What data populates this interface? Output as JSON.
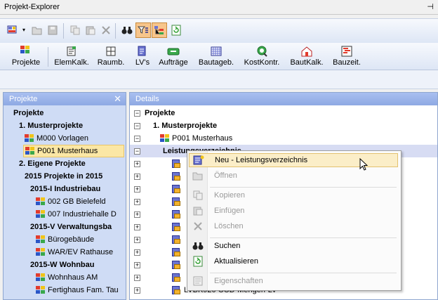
{
  "window": {
    "title": "Projekt-Explorer",
    "pin_icon": "pin-icon"
  },
  "toolbar": {
    "buttons": [
      {
        "name": "new-project-dropdown",
        "icon": "project-grid-icon"
      },
      {
        "name": "open-folder",
        "icon": "folder-open-icon"
      },
      {
        "name": "save",
        "icon": "save-icon"
      },
      {
        "name": "copy",
        "icon": "copy-icon"
      },
      {
        "name": "paste",
        "icon": "paste-icon"
      },
      {
        "name": "delete",
        "icon": "delete-icon"
      },
      {
        "name": "search",
        "icon": "binoculars-icon"
      },
      {
        "name": "filter",
        "icon": "filter-icon",
        "active": true
      },
      {
        "name": "tree-view",
        "icon": "tree-view-icon",
        "active": true
      },
      {
        "name": "refresh",
        "icon": "refresh-icon"
      }
    ]
  },
  "nav": {
    "items": [
      {
        "label": "Projekte",
        "icon": "projects-icon"
      },
      {
        "label": "ElemKalk.",
        "icon": "element-calc-icon"
      },
      {
        "label": "Raumb.",
        "icon": "room-book-icon"
      },
      {
        "label": "LV's",
        "icon": "lv-icon"
      },
      {
        "label": "Aufträge",
        "icon": "orders-icon"
      },
      {
        "label": "Bautageb.",
        "icon": "diary-icon"
      },
      {
        "label": "KostKontr.",
        "icon": "cost-control-icon"
      },
      {
        "label": "BautKalk.",
        "icon": "construction-calc-icon"
      },
      {
        "label": "Bauzeit.",
        "icon": "schedule-icon"
      }
    ]
  },
  "left_panel": {
    "title": "Projekte",
    "tree": [
      {
        "label": "Projekte",
        "bold": true
      },
      {
        "label": "1. Musterprojekte",
        "bold": true
      },
      {
        "label": "M000 Vorlagen"
      },
      {
        "label": "P001 Musterhaus",
        "selected": true
      },
      {
        "label": "2. Eigene Projekte",
        "bold": true
      },
      {
        "label": "2015 Projekte in 2015",
        "bold": true
      },
      {
        "label": "2015-I Industriebau",
        "bold": true
      },
      {
        "label": "002 GB Bielefeld"
      },
      {
        "label": "007 Industriehalle D"
      },
      {
        "label": "2015-V Verwaltungsba",
        "bold": true
      },
      {
        "label": "Bürogebäude"
      },
      {
        "label": "WAR/EV Rathause"
      },
      {
        "label": "2015-W Wohnbau",
        "bold": true
      },
      {
        "label": "Wohnhaus AM"
      },
      {
        "label": "Fertighaus Fam. Tau"
      }
    ]
  },
  "right_panel": {
    "title": "Details",
    "tree": [
      {
        "label": "Projekte",
        "bold": true,
        "expander": "−"
      },
      {
        "label": "1. Musterprojekte",
        "bold": true,
        "expander": "−"
      },
      {
        "label": "P001 Musterhaus",
        "expander": "−"
      },
      {
        "label": "Leistungsverzeichnis",
        "bold": true,
        "expander": "−",
        "highlight": true
      },
      {
        "expander": "+"
      },
      {
        "expander": "+"
      },
      {
        "expander": "+"
      },
      {
        "expander": "+"
      },
      {
        "expander": "+"
      },
      {
        "expander": "+"
      },
      {
        "expander": "+"
      },
      {
        "expander": "+"
      },
      {
        "expander": "+"
      },
      {
        "expander": "+"
      },
      {
        "label": "LVBK920 CCD-Mengen-LV",
        "expander": "+"
      }
    ]
  },
  "context_menu": {
    "items": [
      {
        "label": "Neu - Leistungsverzeichnis",
        "icon": "new-lv-icon",
        "hover": true
      },
      {
        "label": "Öffnen",
        "icon": "open-folder-icon",
        "disabled": true
      },
      {
        "sep": true
      },
      {
        "label": "Kopieren",
        "icon": "copy-icon",
        "disabled": true
      },
      {
        "label": "Einfügen",
        "icon": "paste-icon",
        "disabled": true
      },
      {
        "label": "Löschen",
        "icon": "delete-icon",
        "disabled": true
      },
      {
        "sep": true
      },
      {
        "label": "Suchen",
        "icon": "binoculars-icon"
      },
      {
        "label": "Aktualisieren",
        "icon": "refresh-icon"
      },
      {
        "sep": true
      },
      {
        "label": "Eigenschaften",
        "icon": "properties-icon",
        "disabled": true
      }
    ]
  },
  "colors": {
    "accent": "#8ea9e3",
    "selection": "#fbe7a5",
    "toolbar_active": "#f7c58b",
    "row_highlight": "#d7dcf3"
  }
}
